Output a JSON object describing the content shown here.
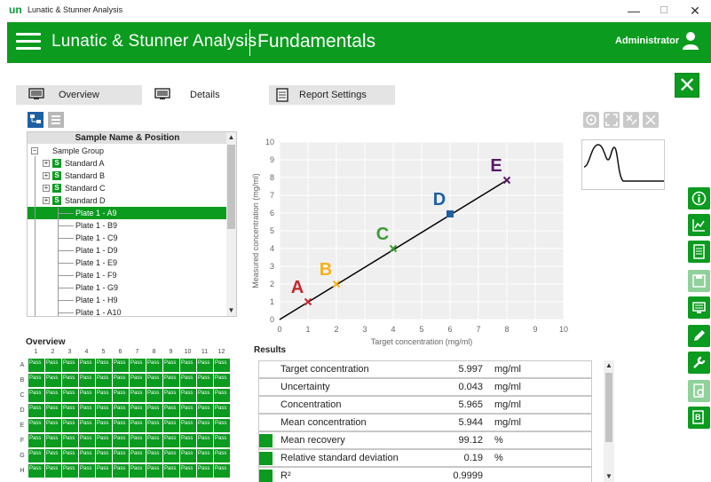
{
  "window": {
    "title": "Lunatic & Stunner Analysis",
    "logo": "un",
    "minimize": "—",
    "maximize": "☐",
    "close": "✕"
  },
  "header": {
    "app_title": "Lunatic & Stunner Analysis",
    "section_title": "Fundamentals",
    "user": "Administrator"
  },
  "tabs": [
    {
      "label": "Overview",
      "icon": "monitor-icon"
    },
    {
      "label": "Details",
      "icon": "monitor-detail-icon"
    },
    {
      "label": "Report Settings",
      "icon": "document-icon"
    }
  ],
  "tree": {
    "header": "Sample Name & Position",
    "items": [
      {
        "label": "Sample Group",
        "level": 0
      },
      {
        "label": "Standard A",
        "level": 1,
        "badge": "S"
      },
      {
        "label": "Standard B",
        "level": 1,
        "badge": "S"
      },
      {
        "label": "Standard C",
        "level": 1,
        "badge": "S"
      },
      {
        "label": "Standard D",
        "level": 1,
        "badge": "S"
      },
      {
        "label": "Plate 1 - A9",
        "level": 2,
        "selected": true
      },
      {
        "label": "Plate 1 - B9",
        "level": 2
      },
      {
        "label": "Plate 1 - C9",
        "level": 2
      },
      {
        "label": "Plate 1 - D9",
        "level": 2
      },
      {
        "label": "Plate 1 - E9",
        "level": 2
      },
      {
        "label": "Plate 1 - F9",
        "level": 2
      },
      {
        "label": "Plate 1 - G9",
        "level": 2
      },
      {
        "label": "Plate 1 - H9",
        "level": 2
      },
      {
        "label": "Plate 1 - A10",
        "level": 2
      }
    ]
  },
  "overview": {
    "title": "Overview",
    "columns": [
      "1",
      "2",
      "3",
      "4",
      "5",
      "6",
      "7",
      "8",
      "9",
      "10",
      "11",
      "12"
    ],
    "rows": [
      "A",
      "B",
      "C",
      "D",
      "E",
      "F",
      "G",
      "H"
    ],
    "well_text": "Pass"
  },
  "chart_data": {
    "type": "scatter",
    "xlabel": "Target concentration (mg/ml)",
    "ylabel": "Measured concentration (mg/ml)",
    "xlim": [
      0,
      10
    ],
    "ylim": [
      0,
      10
    ],
    "xticks": [
      "0",
      "1",
      "2",
      "3",
      "4",
      "5",
      "6",
      "7",
      "8",
      "9",
      "10"
    ],
    "yticks": [
      "0",
      "1",
      "2",
      "3",
      "4",
      "5",
      "6",
      "7",
      "8",
      "9",
      "10"
    ],
    "grid": true,
    "line": {
      "x": [
        0,
        8
      ],
      "y": [
        0,
        7.85
      ],
      "color": "#000000"
    },
    "points": [
      {
        "label": "A",
        "x": 1,
        "y": 1,
        "color": "#c0282d",
        "marker": "x"
      },
      {
        "label": "B",
        "x": 2,
        "y": 2,
        "color": "#f4b21a",
        "marker": "x"
      },
      {
        "label": "C",
        "x": 4,
        "y": 4,
        "color": "#3d9b35",
        "marker": "x"
      },
      {
        "label": "D",
        "x": 6,
        "y": 5.95,
        "color": "#1f5fa3",
        "marker": "square"
      },
      {
        "label": "E",
        "x": 8,
        "y": 7.85,
        "color": "#5a1a6a",
        "marker": "x"
      }
    ]
  },
  "results": {
    "title": "Results",
    "rows": [
      {
        "label": "Target concentration",
        "value": "5.997",
        "unit": "mg/ml",
        "marker": false
      },
      {
        "label": "Uncertainty",
        "value": "0.043",
        "unit": "mg/ml",
        "marker": false
      },
      {
        "label": "Concentration",
        "value": "5.965",
        "unit": "mg/ml",
        "marker": false
      },
      {
        "label": "Mean concentration",
        "value": "5.944",
        "unit": "mg/ml",
        "marker": false
      },
      {
        "label": "Mean recovery",
        "value": "99.12",
        "unit": "%",
        "marker": true
      },
      {
        "label": "Relative standard deviation",
        "value": "0.19",
        "unit": "%",
        "marker": true
      },
      {
        "label": "R²",
        "value": "0.9999",
        "unit": "",
        "marker": true
      }
    ]
  },
  "side_toolbar": [
    {
      "name": "info-icon",
      "enabled": true
    },
    {
      "name": "chart-icon",
      "enabled": true
    },
    {
      "name": "report-icon",
      "enabled": true
    },
    {
      "name": "save-icon",
      "enabled": false
    },
    {
      "name": "keyboard-icon",
      "enabled": true
    },
    {
      "name": "pen-icon",
      "enabled": true
    },
    {
      "name": "wrench-icon",
      "enabled": true
    },
    {
      "name": "preview-icon",
      "enabled": false
    },
    {
      "name": "export-icon",
      "enabled": true
    }
  ],
  "colors": {
    "brand": "#0b9b1f",
    "well": "#0b9b1f"
  }
}
